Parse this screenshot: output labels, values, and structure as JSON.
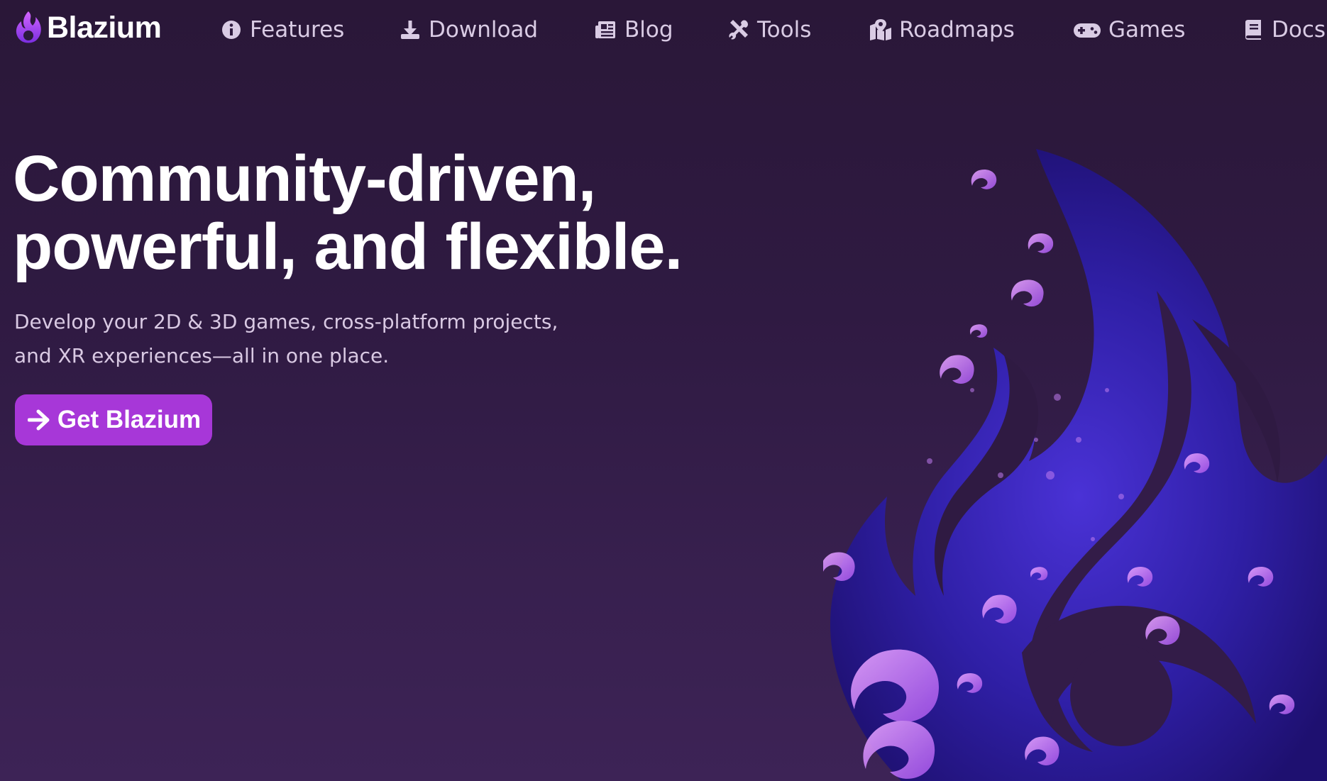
{
  "brand": {
    "name": "Blazium",
    "logo_icon": "flame-logo-icon",
    "accent_color": "#a737d8"
  },
  "nav": {
    "items": [
      {
        "label": "Features",
        "icon": "info-circle-icon"
      },
      {
        "label": "Download",
        "icon": "download-icon"
      },
      {
        "label": "Blog",
        "icon": "newspaper-icon"
      },
      {
        "label": "Tools",
        "icon": "tools-icon"
      },
      {
        "label": "Roadmaps",
        "icon": "map-pin-icon"
      },
      {
        "label": "Games",
        "icon": "gamepad-icon"
      },
      {
        "label": "Docs",
        "icon": "book-icon"
      }
    ]
  },
  "hero": {
    "title_line1": "Community-driven,",
    "title_line2": "powerful, and flexible.",
    "subtitle_line1": "Develop your 2D & 3D games, cross-platform projects,",
    "subtitle_line2": "and XR experiences—all in one place.",
    "cta_label": "Get Blazium",
    "cta_icon": "arrow-right-icon",
    "art": "flame-artwork"
  },
  "colors": {
    "background_top": "#2a1738",
    "background_bottom": "#3d2356",
    "nav_text": "#d9cbe4",
    "flame_fill": "#2a1797"
  }
}
